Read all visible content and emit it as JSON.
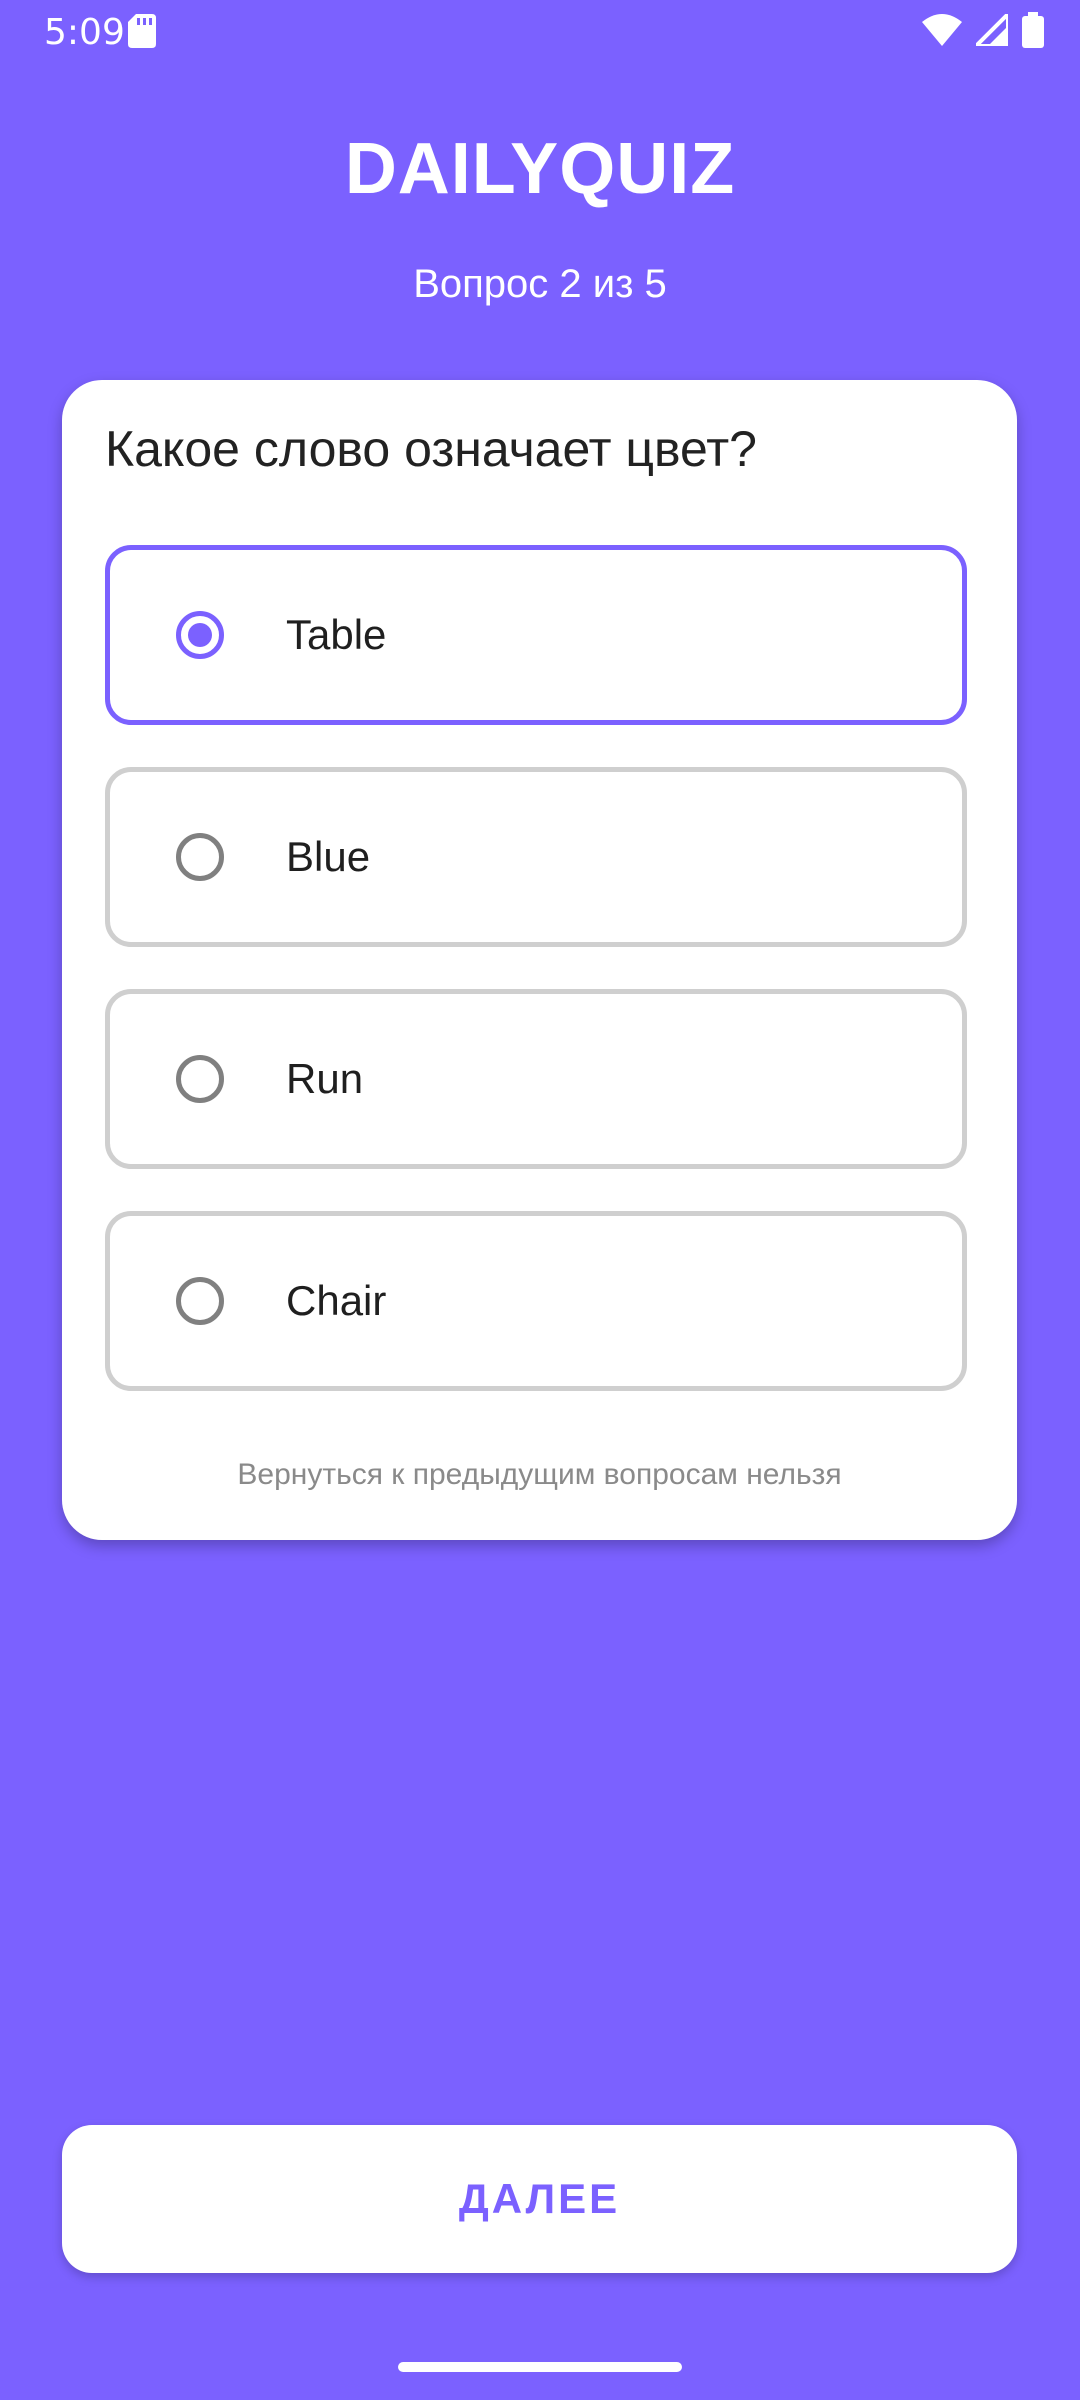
{
  "status_bar": {
    "time": "5:09",
    "icons": [
      "sd-card-icon",
      "wifi-icon",
      "signal-icon",
      "battery-icon"
    ]
  },
  "header": {
    "title": "DAILYQUIZ",
    "progress": "Вопрос 2 из 5"
  },
  "quiz": {
    "question": "Какое слово означает цвет?",
    "options": [
      {
        "label": "Table",
        "selected": true
      },
      {
        "label": "Blue",
        "selected": false
      },
      {
        "label": "Run",
        "selected": false
      },
      {
        "label": "Chair",
        "selected": false
      }
    ],
    "note": "Вернуться к предыдущим вопросам нельзя"
  },
  "actions": {
    "next_label": "ДАЛЕЕ"
  },
  "colors": {
    "background": "#7B61FF",
    "accent": "#7B61FF",
    "card": "#FFFFFF",
    "option_border": "#CFCFCF"
  }
}
